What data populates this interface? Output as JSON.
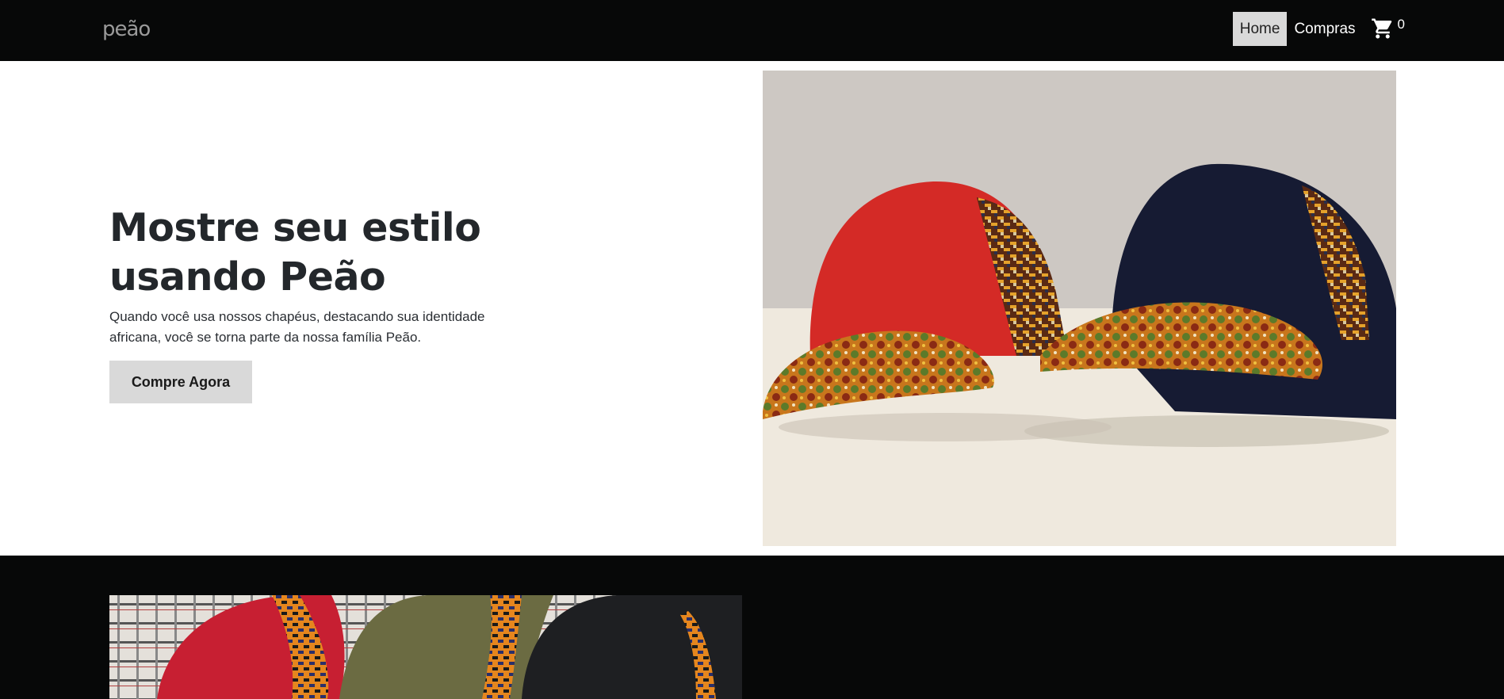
{
  "navbar": {
    "logo_text": "peão",
    "links": [
      {
        "label": "Home",
        "active": true
      },
      {
        "label": "Compras",
        "active": false
      }
    ],
    "cart": {
      "icon": "cart-icon",
      "count": "0"
    }
  },
  "hero": {
    "title_line1": "Mostre seu estilo",
    "title_line2": "usando Peão",
    "subtitle": "Quando você usa nossos chapéus, destacando sua identidade africana, você se torna parte da nossa família Peão.",
    "cta_label": "Compre Agora",
    "image": "red-and-navy-caps-photo"
  },
  "section2": {
    "image": "caps-collection-photo"
  },
  "colors": {
    "nav_bg": "#070808",
    "active_link_bg": "#d9d9d9",
    "cta_bg": "#d9d9d9",
    "text_dark": "#23272b"
  }
}
